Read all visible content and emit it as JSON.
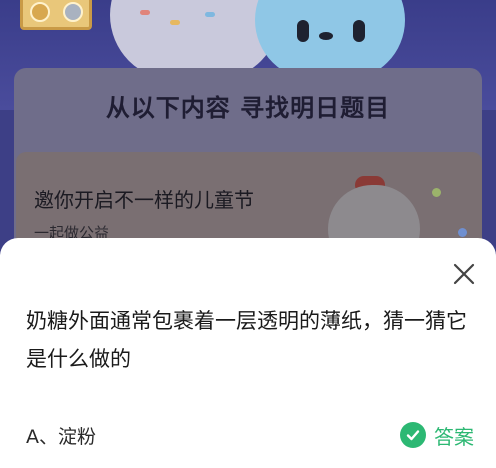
{
  "background": {
    "panel_title": "从以下内容 寻找明日题目",
    "promo_title": "邀你开启不一样的儿童节",
    "promo_subtitle": "一起做公益"
  },
  "sheet": {
    "question": "奶糖外面通常包裹着一层透明的薄纸，猜一猜它是什么做的",
    "option_label": "A、淀粉",
    "answer_label": "答案",
    "close_icon": "close-icon",
    "check_icon": "check-circle-icon"
  },
  "colors": {
    "accent_green": "#2cb873",
    "sheet_bg": "#ffffff",
    "overlay_bg": "#3d3f86"
  }
}
